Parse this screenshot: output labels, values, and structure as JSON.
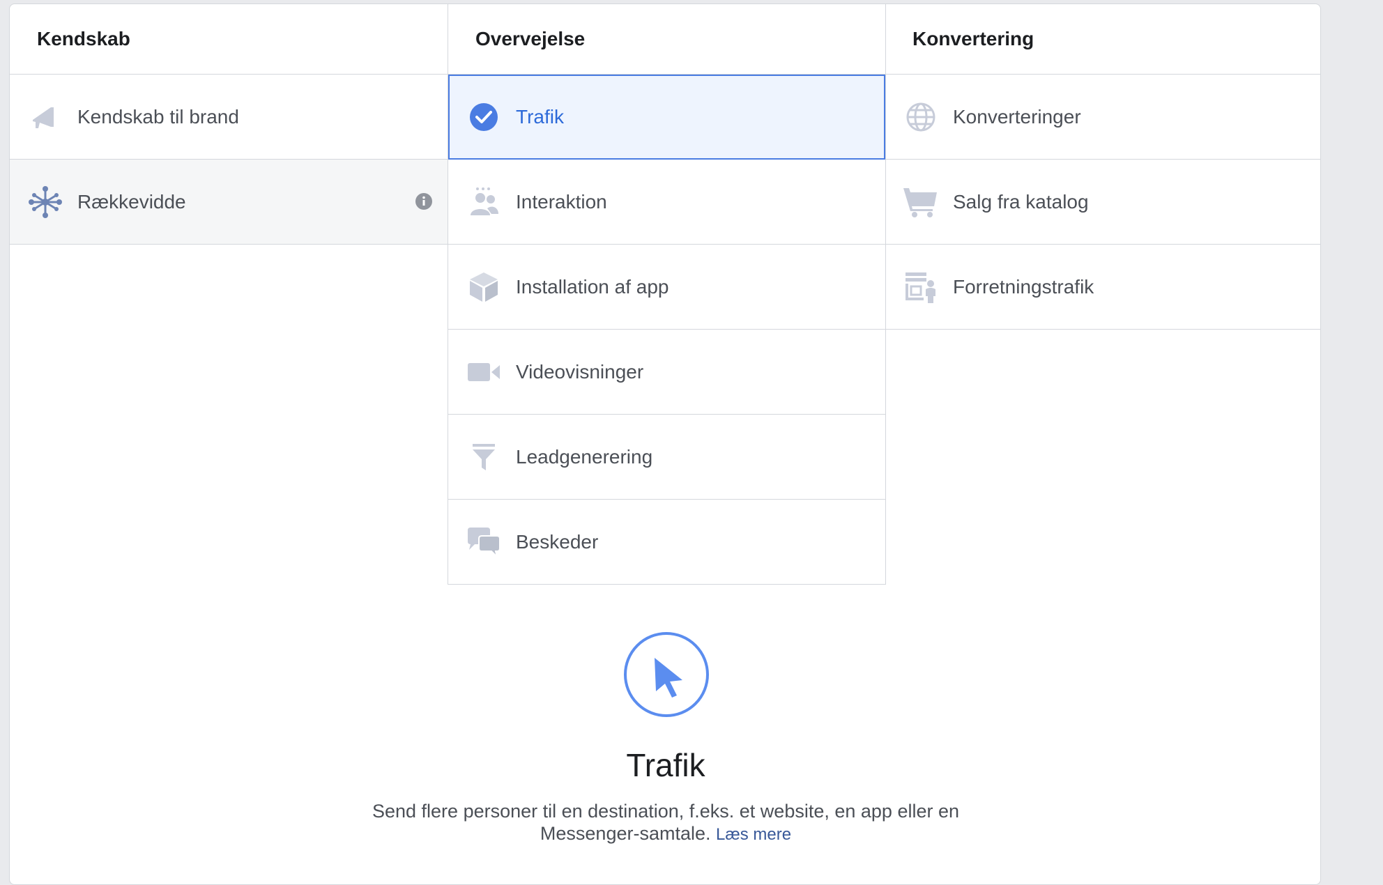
{
  "columns": {
    "awareness": {
      "header": "Kendskab",
      "items": [
        {
          "label": "Kendskab til brand",
          "icon": "megaphone-icon"
        },
        {
          "label": "Rækkevidde",
          "icon": "reach-icon"
        }
      ]
    },
    "consideration": {
      "header": "Overvejelse",
      "items": [
        {
          "label": "Trafik",
          "icon": "checkmark-circle-icon"
        },
        {
          "label": "Interaktion",
          "icon": "people-icon"
        },
        {
          "label": "Installation af app",
          "icon": "box-icon"
        },
        {
          "label": "Videovisninger",
          "icon": "video-camera-icon"
        },
        {
          "label": "Leadgenerering",
          "icon": "funnel-icon"
        },
        {
          "label": "Beskeder",
          "icon": "chat-bubbles-icon"
        }
      ]
    },
    "conversion": {
      "header": "Konvertering",
      "items": [
        {
          "label": "Konverteringer",
          "icon": "globe-icon"
        },
        {
          "label": "Salg fra katalog",
          "icon": "shopping-cart-icon"
        },
        {
          "label": "Forretningstrafik",
          "icon": "store-icon"
        }
      ]
    }
  },
  "selected_objective": "Trafik",
  "detail": {
    "icon": "cursor-icon",
    "title": "Trafik",
    "description": "Send flere personer til en destination, f.eks. et website, en app eller en Messenger-samtale.",
    "learn_more": "Læs mere"
  },
  "colors": {
    "accent": "#4a7ce2",
    "selected_bg": "#eef4fe",
    "icon_grey": "#c7ccd9",
    "reach_icon": "#6d84b4"
  }
}
